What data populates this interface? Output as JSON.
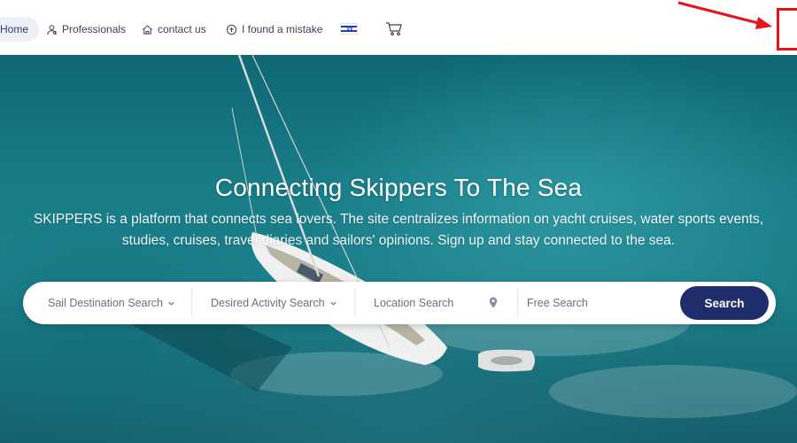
{
  "nav": {
    "home": "Home",
    "professionals": "Professionals",
    "contact": "contact us",
    "mistake": "I found a mistake",
    "language_flag_icon": "israel-flag-icon",
    "cart_icon": "cart-icon"
  },
  "hero": {
    "title": "Connecting Skippers To The Sea",
    "subtitle": "SKIPPERS is a platform that connects sea lovers. The site centralizes information on yacht cruises, water sports events, studies, cruises, travel diaries and sailors' opinions. Sign up and stay connected to the sea."
  },
  "search": {
    "sail_destination": "Sail Destination Search",
    "desired_activity": "Desired Activity Search",
    "location": "Location Search",
    "free_search_placeholder": "Free Search",
    "button": "Search"
  },
  "colors": {
    "accent": "#1f2d6b",
    "annotation": "#e8131b",
    "sea": "#197d88"
  }
}
